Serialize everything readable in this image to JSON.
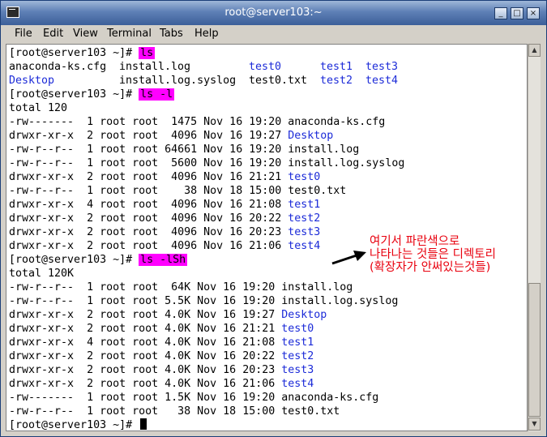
{
  "window": {
    "title": "root@server103:~",
    "buttons": {
      "minimize": "_",
      "maximize": "□",
      "close": "×"
    }
  },
  "menu": [
    "File",
    "Edit",
    "View",
    "Terminal",
    "Tabs",
    "Help"
  ],
  "terminal": {
    "prompt": "[root@server103 ~]# ",
    "cmd1": "ls",
    "ls_row1": {
      "a": "anaconda-ks.cfg",
      "b": "install.log",
      "c": "test0",
      "d": "test1",
      "e": "test3"
    },
    "ls_row2": {
      "a": "Desktop",
      "b": "install.log.syslog",
      "c": "test0.txt",
      "d": "test2",
      "e": "test4"
    },
    "cmd2": "ls -l",
    "total1": "total 120",
    "long1": [
      {
        "meta": "-rw-------  1 root root  1475 Nov 16 19:20 ",
        "name": "anaconda-ks.cfg",
        "dir": false
      },
      {
        "meta": "drwxr-xr-x  2 root root  4096 Nov 16 19:27 ",
        "name": "Desktop",
        "dir": true
      },
      {
        "meta": "-rw-r--r--  1 root root 64661 Nov 16 19:20 ",
        "name": "install.log",
        "dir": false
      },
      {
        "meta": "-rw-r--r--  1 root root  5600 Nov 16 19:20 ",
        "name": "install.log.syslog",
        "dir": false
      },
      {
        "meta": "drwxr-xr-x  2 root root  4096 Nov 16 21:21 ",
        "name": "test0",
        "dir": true
      },
      {
        "meta": "-rw-r--r--  1 root root    38 Nov 18 15:00 ",
        "name": "test0.txt",
        "dir": false
      },
      {
        "meta": "drwxr-xr-x  4 root root  4096 Nov 16 21:08 ",
        "name": "test1",
        "dir": true
      },
      {
        "meta": "drwxr-xr-x  2 root root  4096 Nov 16 20:22 ",
        "name": "test2",
        "dir": true
      },
      {
        "meta": "drwxr-xr-x  2 root root  4096 Nov 16 20:23 ",
        "name": "test3",
        "dir": true
      },
      {
        "meta": "drwxr-xr-x  2 root root  4096 Nov 16 21:06 ",
        "name": "test4",
        "dir": true
      }
    ],
    "cmd3": "ls -lSh",
    "total2": "total 120K",
    "long2": [
      {
        "meta": "-rw-r--r--  1 root root  64K Nov 16 19:20 ",
        "name": "install.log",
        "dir": false
      },
      {
        "meta": "-rw-r--r--  1 root root 5.5K Nov 16 19:20 ",
        "name": "install.log.syslog",
        "dir": false
      },
      {
        "meta": "drwxr-xr-x  2 root root 4.0K Nov 16 19:27 ",
        "name": "Desktop",
        "dir": true
      },
      {
        "meta": "drwxr-xr-x  2 root root 4.0K Nov 16 21:21 ",
        "name": "test0",
        "dir": true
      },
      {
        "meta": "drwxr-xr-x  4 root root 4.0K Nov 16 21:08 ",
        "name": "test1",
        "dir": true
      },
      {
        "meta": "drwxr-xr-x  2 root root 4.0K Nov 16 20:22 ",
        "name": "test2",
        "dir": true
      },
      {
        "meta": "drwxr-xr-x  2 root root 4.0K Nov 16 20:23 ",
        "name": "test3",
        "dir": true
      },
      {
        "meta": "drwxr-xr-x  2 root root 4.0K Nov 16 21:06 ",
        "name": "test4",
        "dir": true
      },
      {
        "meta": "-rw-------  1 root root 1.5K Nov 16 19:20 ",
        "name": "anaconda-ks.cfg",
        "dir": false
      },
      {
        "meta": "-rw-r--r--  1 root root   38 Nov 18 15:00 ",
        "name": "test0.txt",
        "dir": false
      }
    ]
  },
  "annotation": {
    "line1": "여기서 파란색으로",
    "line2": "나타나는 것들은 디렉토리",
    "line3": "(확장자가 안써있는것들)",
    "color": "#e8000e"
  },
  "colors": {
    "directory": "#1c2bd8",
    "command_highlight": "#ff00ff"
  }
}
